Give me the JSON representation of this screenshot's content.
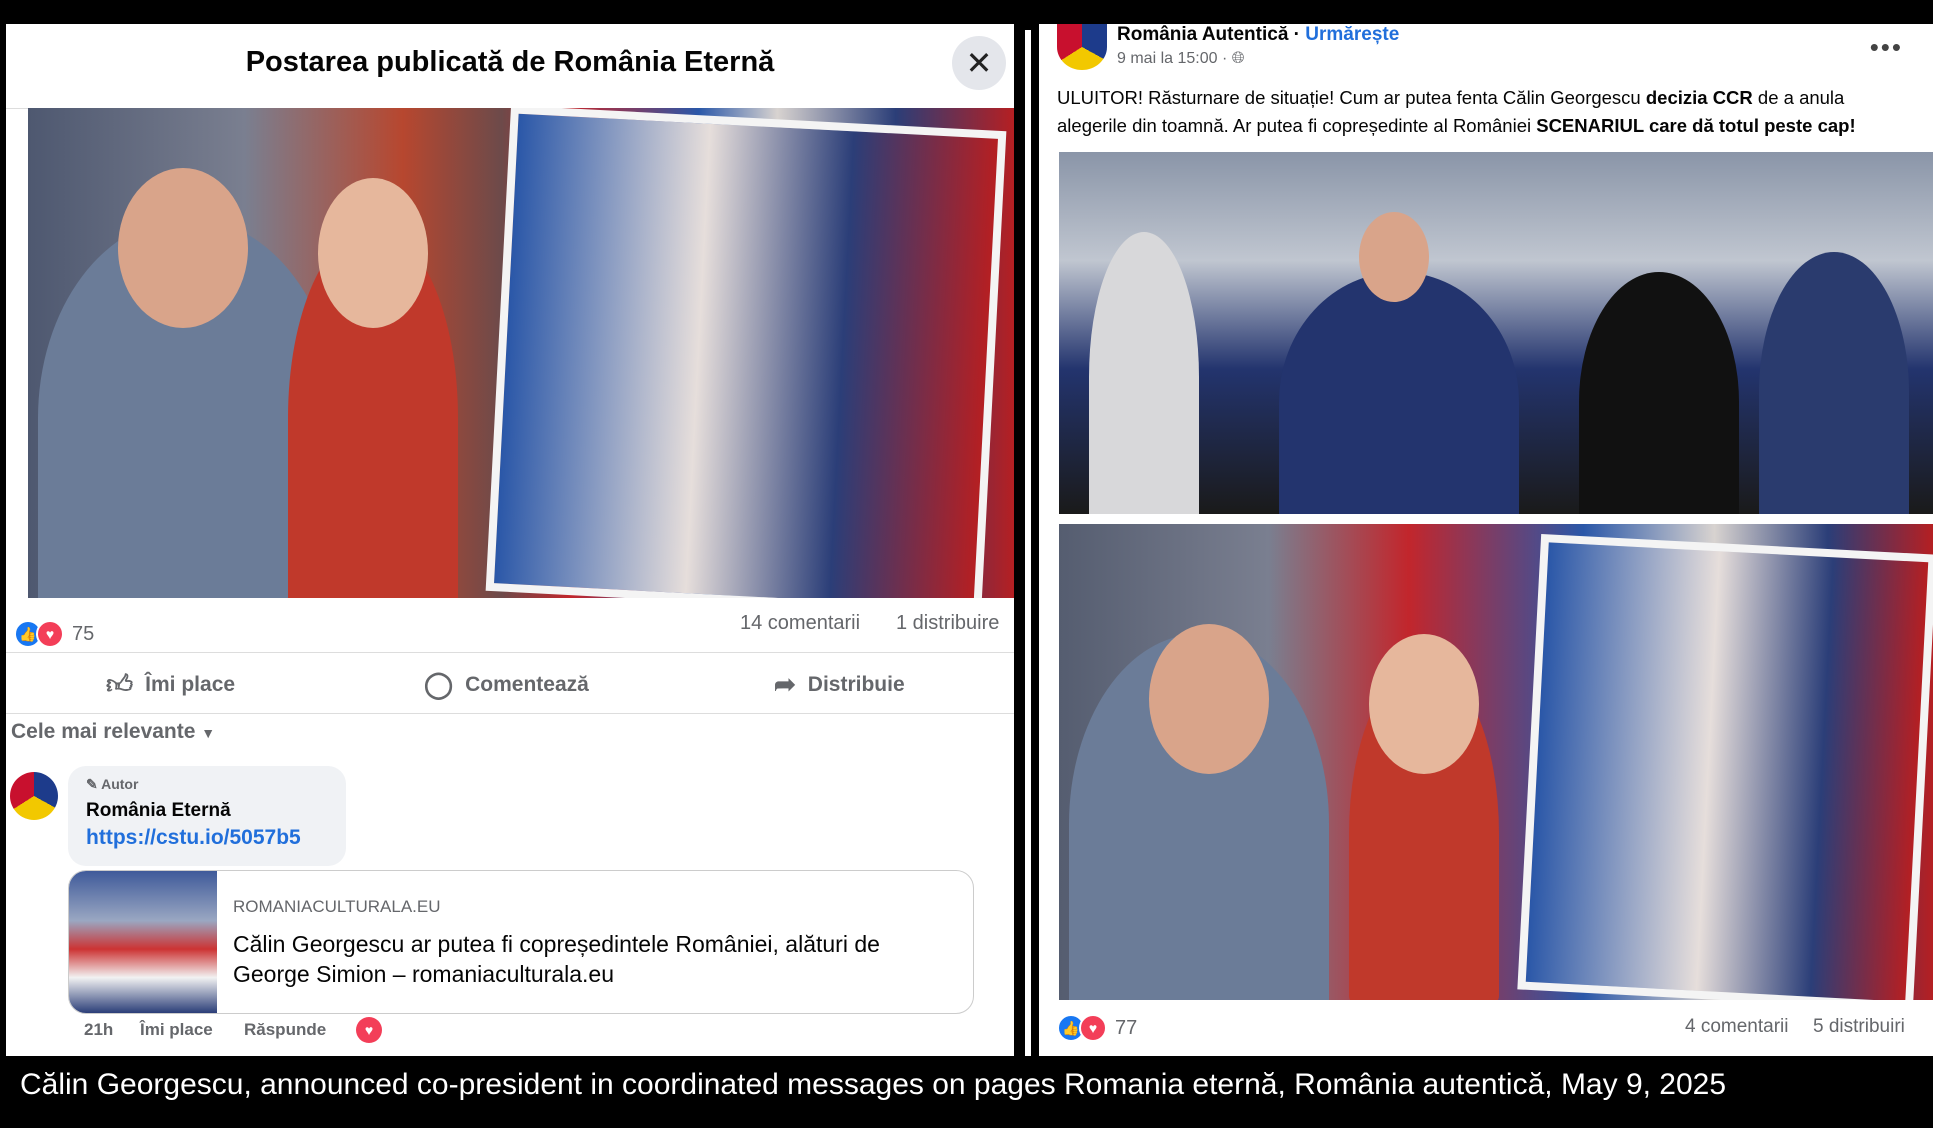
{
  "left_post": {
    "header_title": "Postarea publicată de România Eternă",
    "close_symbol": "✕",
    "reactions_count": "75",
    "comments": "14 comentarii",
    "shares": "1 distribuire",
    "actions": {
      "like": "Îmi place",
      "comment": "Comentează",
      "share": "Distribuie"
    },
    "sort_label": "Cele mai relevante",
    "comment": {
      "badge": "Autor",
      "author": "România Eternă",
      "link": "https://cstu.io/5057b5",
      "card_domain": "ROMANIACULTURALA.EU",
      "card_title": "Călin Georgescu ar putea fi copreședintele României, alături de George Simion – romaniaculturala.eu",
      "time": "21h",
      "like": "Îmi place",
      "reply": "Răspunde"
    }
  },
  "right_post": {
    "page_name": "România Autentică",
    "follow": "Urmărește",
    "time": "9 mai la 15:00",
    "text_parts": {
      "p1": "ULUITOR! Răsturnare de situație! Cum ar putea fenta Călin Georgescu ",
      "b1": "decizia CCR",
      "p2": " de a anula alegerile din toamnă. Ar putea fi copreședinte al României ",
      "b2": "SCENARIUL care dă totul peste cap!"
    },
    "reactions_count": "77",
    "comments": "4 comentarii",
    "shares": "5 distribuiri"
  },
  "caption": "Călin Georgescu, announced co-president in coordinated messages on pages Romania eternă, România autentică, May 9, 2025",
  "colors": {
    "accent": "#1877f2",
    "love": "#f33e58",
    "link": "#216fdb"
  }
}
